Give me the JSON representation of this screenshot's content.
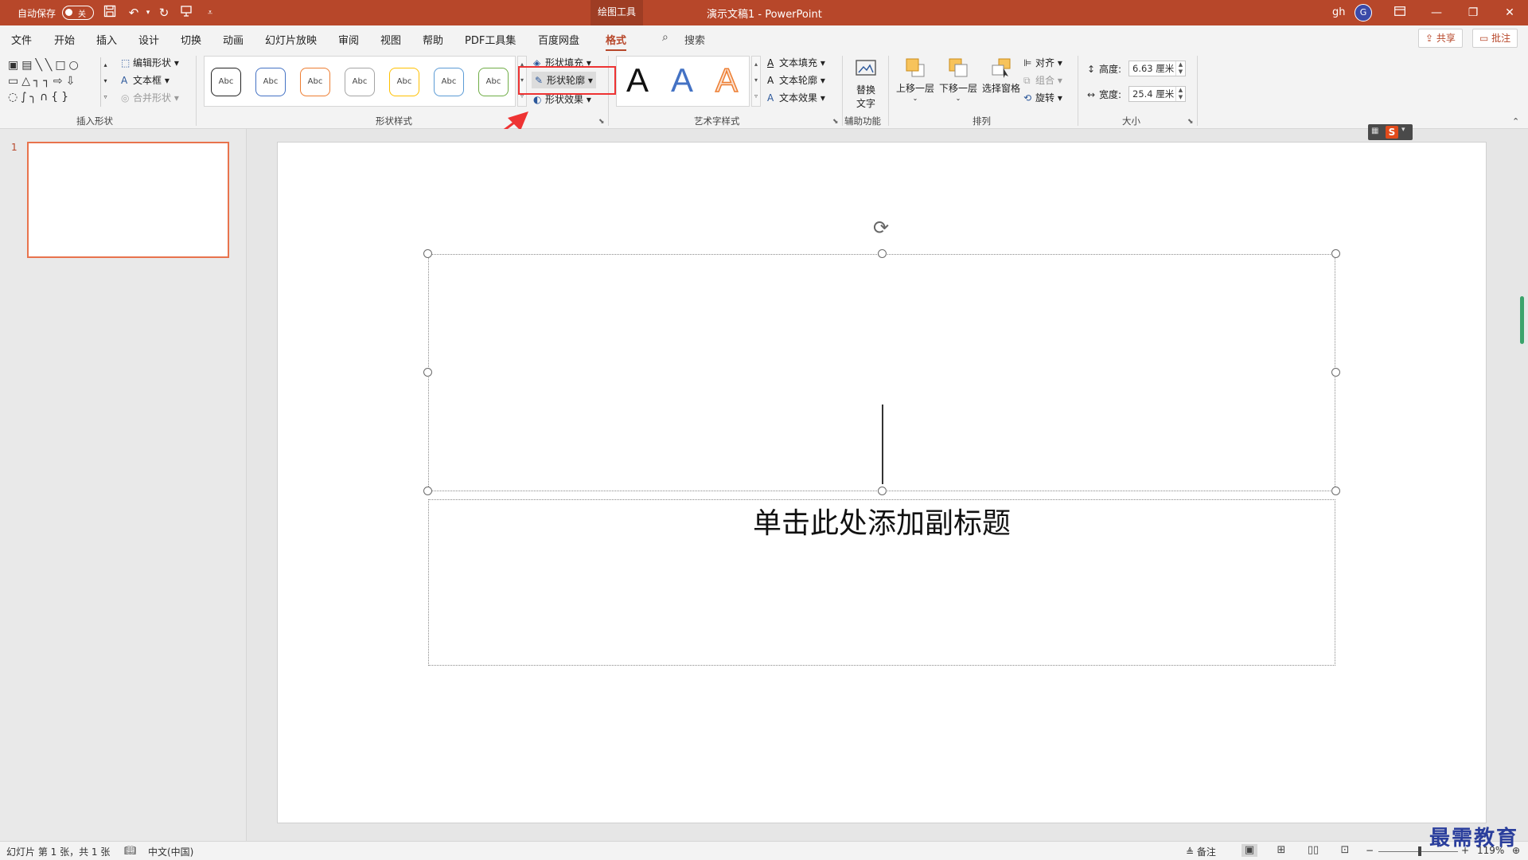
{
  "titlebar": {
    "autosave_label": "自动保存",
    "autosave_state": "关",
    "tools_tab": "绘图工具",
    "doc_title": "演示文稿1  -  PowerPoint",
    "user": "gh",
    "avatar_initial": "G"
  },
  "menu": {
    "tabs": [
      "文件",
      "开始",
      "插入",
      "设计",
      "切换",
      "动画",
      "幻灯片放映",
      "审阅",
      "视图",
      "帮助",
      "PDF工具集",
      "百度网盘",
      "格式"
    ],
    "active_tab": "格式",
    "search_label": "搜索",
    "share_label": "共享",
    "comment_label": "批注"
  },
  "ribbon": {
    "insert_shapes": {
      "label": "插入形状",
      "edit_shape": "编辑形状",
      "text_box": "文本框",
      "merge_shapes": "合并形状"
    },
    "shape_styles": {
      "label": "形状样式",
      "style_item_text": "Abc",
      "style_colors": [
        "#222222",
        "#4472c4",
        "#ed7d31",
        "#a5a5a5",
        "#ffc000",
        "#5b9bd5",
        "#70ad47"
      ],
      "fill": "形状填充",
      "outline": "形状轮廓",
      "effects": "形状效果"
    },
    "wordart": {
      "label": "艺术字样式",
      "glyph": "A",
      "text_fill": "文本填充",
      "text_outline": "文本轮廓",
      "text_effects": "文本效果"
    },
    "accessibility": {
      "label": "辅助功能",
      "alt_text_line1": "替换",
      "alt_text_line2": "文字"
    },
    "arrange": {
      "label": "排列",
      "bring_forward": "上移一层",
      "send_backward": "下移一层",
      "selection_pane": "选择窗格",
      "align": "对齐",
      "group": "组合",
      "rotate": "旋转"
    },
    "size": {
      "label": "大小",
      "height_label": "高度:",
      "height_value": "6.63 厘米",
      "width_label": "宽度:",
      "width_value": "25.4 厘米"
    }
  },
  "thumbnails": {
    "slide_number": "1"
  },
  "slide": {
    "subtitle_placeholder": "单击此处添加副标题"
  },
  "statusbar": {
    "slide_info": "幻灯片 第 1 张，共 1 张",
    "language": "中文(中国)",
    "notes": "备注",
    "zoom": "119%"
  },
  "watermark": "最需教育",
  "colors": {
    "accent": "#b7472a",
    "highlight": "#e33333"
  }
}
